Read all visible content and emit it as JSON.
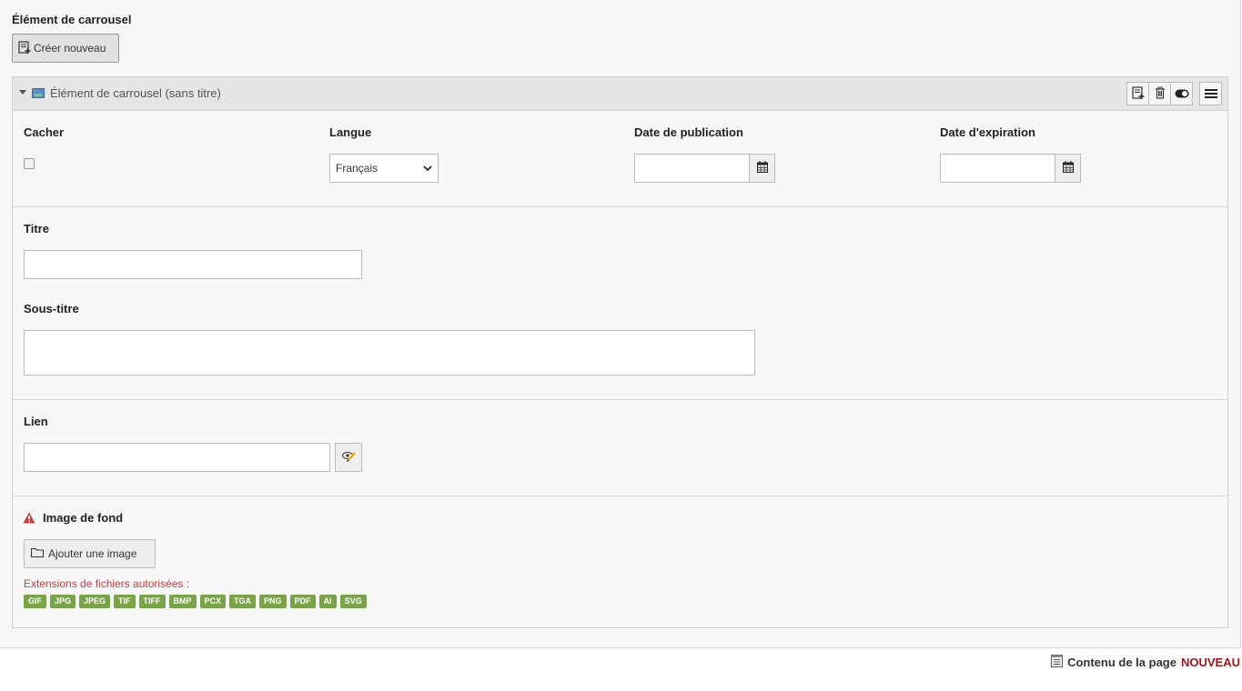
{
  "section": {
    "title": "Élément de carrousel"
  },
  "create_button": {
    "label": "Créer nouveau",
    "icon": "new-record-icon"
  },
  "panel": {
    "header_title": "Élément de carrousel (sans titre)",
    "header_icon": "image-icon",
    "actions": [
      "new-record-icon",
      "trash-icon",
      "toggle-icon",
      "menu-icon"
    ]
  },
  "fields": {
    "hide": {
      "label": "Cacher",
      "checked": false
    },
    "language": {
      "label": "Langue",
      "value": "Français"
    },
    "publish_date": {
      "label": "Date de publication",
      "value": ""
    },
    "expire_date": {
      "label": "Date d'expiration",
      "value": ""
    },
    "title": {
      "label": "Titre",
      "value": ""
    },
    "subtitle": {
      "label": "Sous-titre",
      "value": ""
    },
    "link": {
      "label": "Lien",
      "value": ""
    },
    "background_image": {
      "label": "Image de fond",
      "warning_icon": "warning-icon",
      "add_button": "Ajouter une image",
      "allowed_label": "Extensions de fichiers autorisées :",
      "extensions": [
        "GIF",
        "JPG",
        "JPEG",
        "TIF",
        "TIFF",
        "BMP",
        "PCX",
        "TGA",
        "PNG",
        "PDF",
        "AI",
        "SVG"
      ]
    }
  },
  "footer": {
    "text": "Contenu de la page",
    "badge": "NOUVEAU"
  },
  "colors": {
    "accent_red": "#a4161a",
    "tag_green": "#79a548",
    "warning_red": "#c83c3c"
  }
}
